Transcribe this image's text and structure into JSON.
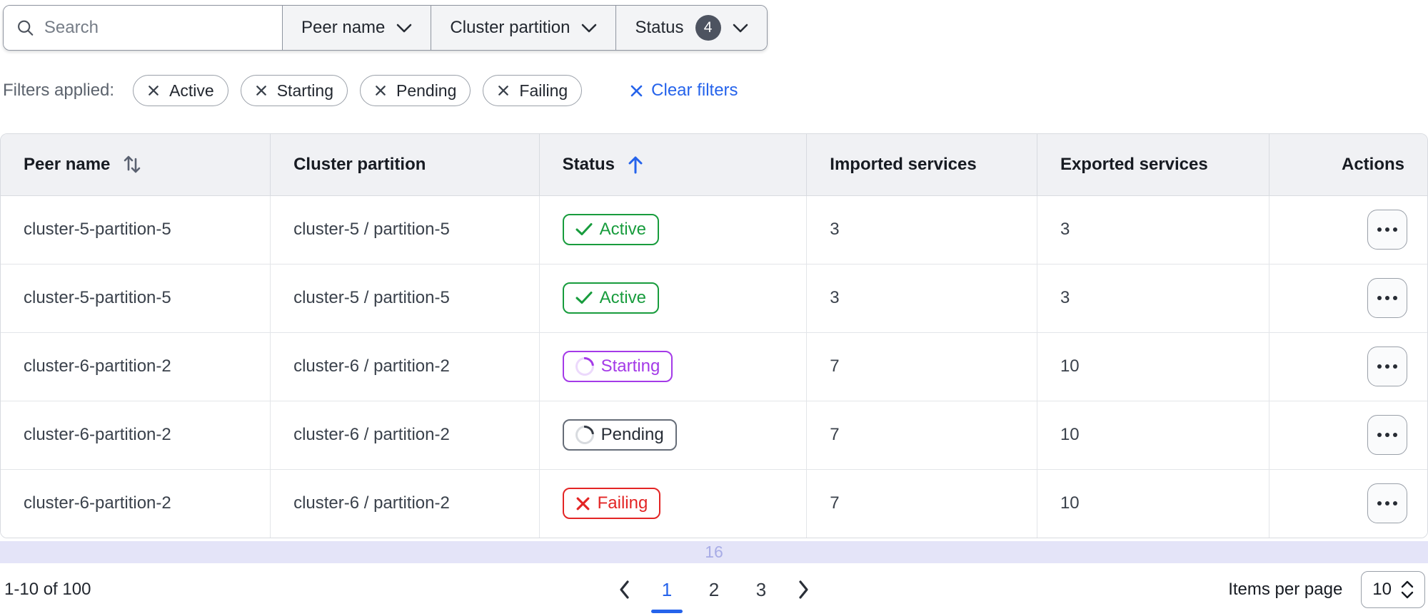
{
  "toolbar": {
    "search_placeholder": "Search",
    "dropdowns": [
      {
        "label": "Peer name"
      },
      {
        "label": "Cluster partition"
      },
      {
        "label": "Status",
        "badge": "4"
      }
    ]
  },
  "filters": {
    "label": "Filters applied:",
    "chips": [
      "Active",
      "Starting",
      "Pending",
      "Failing"
    ],
    "clear_label": "Clear filters"
  },
  "table": {
    "columns": [
      "Peer name",
      "Cluster partition",
      "Status",
      "Imported services",
      "Exported services",
      "Actions"
    ],
    "sort": {
      "column": "Status",
      "direction": "ascending",
      "peer_name_sortable": true
    },
    "rows": [
      {
        "peer_name": "cluster-5-partition-5",
        "cluster_partition": "cluster-5 / partition-5",
        "status": "Active",
        "imported": "3",
        "exported": "3"
      },
      {
        "peer_name": "cluster-5-partition-5",
        "cluster_partition": "cluster-5 / partition-5",
        "status": "Active",
        "imported": "3",
        "exported": "3"
      },
      {
        "peer_name": "cluster-6-partition-2",
        "cluster_partition": "cluster-6 / partition-2",
        "status": "Starting",
        "imported": "7",
        "exported": "10"
      },
      {
        "peer_name": "cluster-6-partition-2",
        "cluster_partition": "cluster-6 / partition-2",
        "status": "Pending",
        "imported": "7",
        "exported": "10"
      },
      {
        "peer_name": "cluster-6-partition-2",
        "cluster_partition": "cluster-6 / partition-2",
        "status": "Failing",
        "imported": "7",
        "exported": "10"
      }
    ],
    "overflow_indicator": "16"
  },
  "pagination": {
    "range_label": "1-10 of 100",
    "pages": [
      "1",
      "2",
      "3"
    ],
    "current_page": "1",
    "items_per_page_label": "Items per page",
    "items_per_page_value": "10"
  },
  "colors": {
    "accent": "#2563eb",
    "status_active": "#189c3d",
    "status_starting": "#a43ae8",
    "status_pending": "#272d36",
    "status_pending_border": "#666d78",
    "status_failing": "#e32525",
    "badge_count_bg": "#4d5360",
    "overflow_bar_bg": "#e4e4f8",
    "overflow_bar_text": "#a8ace6"
  }
}
